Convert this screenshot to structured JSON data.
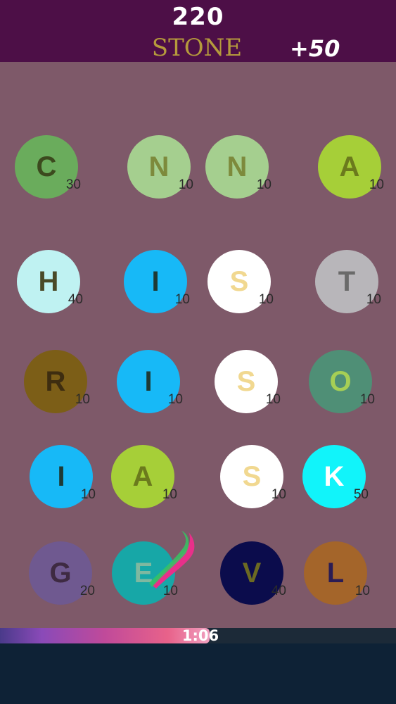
{
  "header": {
    "score": "220",
    "current_word": "STONE",
    "bonus": "+50"
  },
  "tiles": [
    {
      "letter": "C",
      "points": "30",
      "color": "#6aac5c",
      "text_color": "#3c4a1e"
    },
    {
      "letter": "N",
      "points": "10",
      "color": "#a5cf8f",
      "text_color": "#7d8a3c"
    },
    {
      "letter": "N",
      "points": "10",
      "color": "#a5cf8f",
      "text_color": "#7d8a3c"
    },
    {
      "letter": "A",
      "points": "10",
      "color": "#a6cf38",
      "text_color": "#6b7a1d"
    },
    {
      "letter": "H",
      "points": "40",
      "color": "#bff2f2",
      "text_color": "#4a4a28"
    },
    {
      "letter": "I",
      "points": "10",
      "color": "#17b9f7",
      "text_color": "#1e3a34"
    },
    {
      "letter": "S",
      "points": "10",
      "color": "#ffffff",
      "text_color": "#f1d890"
    },
    {
      "letter": "T",
      "points": "10",
      "color": "#b8b6ba",
      "text_color": "#6a6a6a"
    },
    {
      "letter": "R",
      "points": "10",
      "color": "#7c5e17",
      "text_color": "#3e2d10"
    },
    {
      "letter": "I",
      "points": "10",
      "color": "#17b9f7",
      "text_color": "#1e3a34"
    },
    {
      "letter": "S",
      "points": "10",
      "color": "#ffffff",
      "text_color": "#f1d890"
    },
    {
      "letter": "O",
      "points": "10",
      "color": "#4f8f76",
      "text_color": "#a6cf55"
    },
    {
      "letter": "I",
      "points": "10",
      "color": "#17b9f7",
      "text_color": "#1e3a34"
    },
    {
      "letter": "A",
      "points": "10",
      "color": "#a6cf38",
      "text_color": "#6b7a1d"
    },
    {
      "letter": "S",
      "points": "10",
      "color": "#ffffff",
      "text_color": "#f1d890"
    },
    {
      "letter": "K",
      "points": "50",
      "color": "#11f4fa",
      "text_color": "#ffffff"
    },
    {
      "letter": "G",
      "points": "20",
      "color": "#6f5990",
      "text_color": "#3e2a42"
    },
    {
      "letter": "E",
      "points": "10",
      "color": "#17a7a7",
      "text_color": "#7fb8a0"
    },
    {
      "letter": "V",
      "points": "40",
      "color": "#0b0c4c",
      "text_color": "#6c6a22"
    },
    {
      "letter": "L",
      "points": "10",
      "color": "#a4652a",
      "text_color": "#2b1c54"
    }
  ],
  "timer": {
    "time": "1:06",
    "progress": 0.53
  }
}
